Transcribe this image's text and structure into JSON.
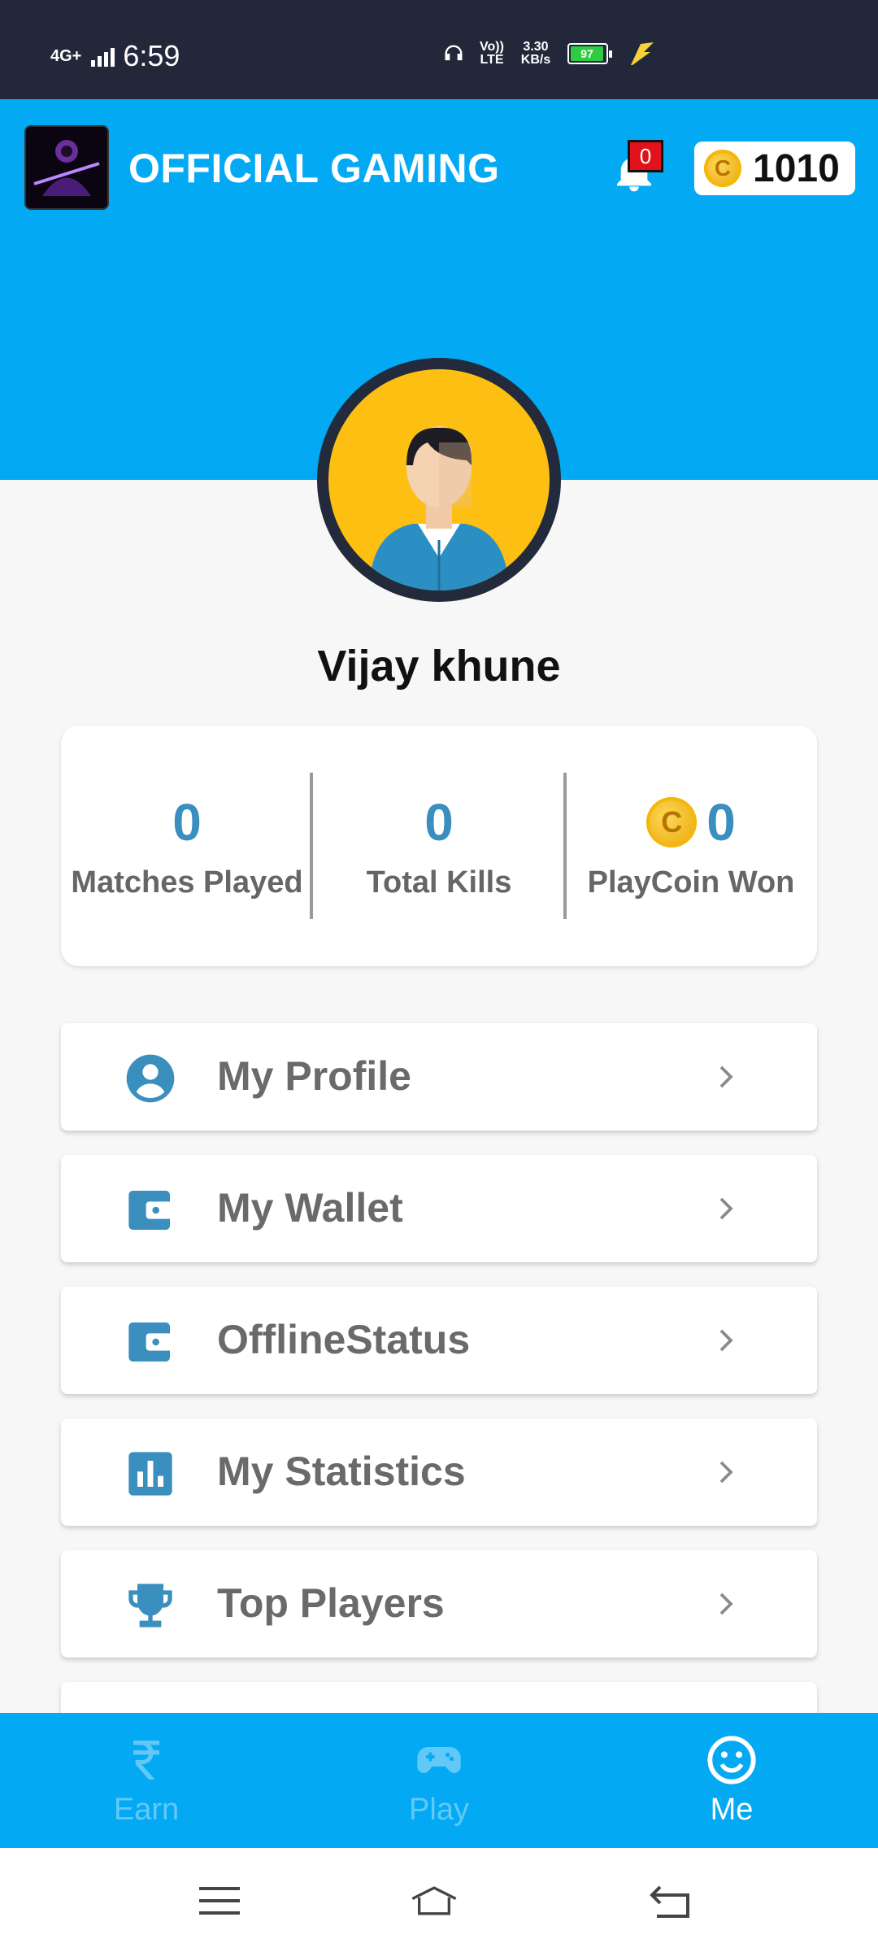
{
  "status_bar": {
    "network": "4G+",
    "time": "6:59",
    "volte": "Vo)) LTE",
    "speed": "3.30 KB/s",
    "battery": "97"
  },
  "header": {
    "title": "OFFICIAL GAMING",
    "notification_count": "0",
    "coin_balance": "1010"
  },
  "profile": {
    "username": "Vijay khune"
  },
  "stats": [
    {
      "value": "0",
      "label": "Matches Played"
    },
    {
      "value": "0",
      "label": "Total Kills"
    },
    {
      "value": "0",
      "label": "PlayCoin Won"
    }
  ],
  "menu": [
    {
      "label": "My Profile",
      "icon": "account-circle-icon"
    },
    {
      "label": "My Wallet",
      "icon": "wallet-icon"
    },
    {
      "label": "OfflineStatus",
      "icon": "wallet-icon"
    },
    {
      "label": "My Statistics",
      "icon": "bar-chart-icon"
    },
    {
      "label": "Top Players",
      "icon": "trophy-icon"
    }
  ],
  "bottom_nav": [
    {
      "label": "Earn",
      "icon": "rupee-icon",
      "active": false
    },
    {
      "label": "Play",
      "icon": "gamepad-icon",
      "active": false
    },
    {
      "label": "Me",
      "icon": "smiley-icon",
      "active": true
    }
  ],
  "colors": {
    "primary": "#04a9f4",
    "status_bar": "#22283a",
    "accent_text": "#3b8fbf",
    "avatar_bg": "#fdc012"
  }
}
